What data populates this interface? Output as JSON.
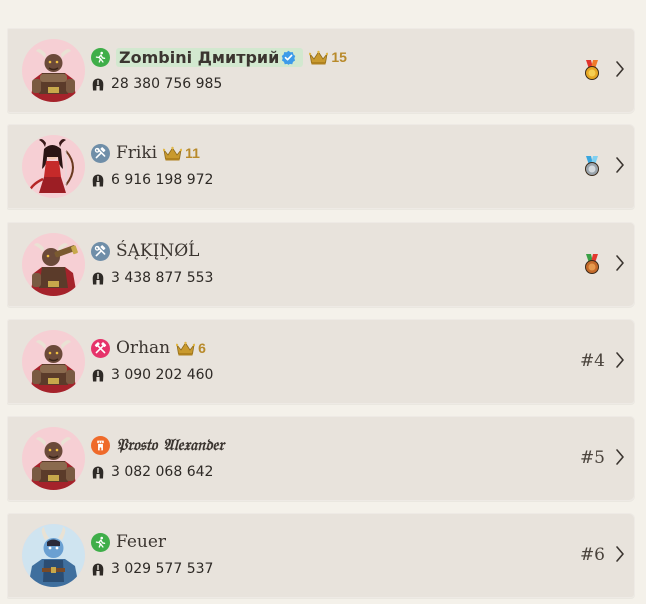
{
  "colors": {
    "card_bg": "#e8e3dc",
    "avatar_bg": "#f6cfd4",
    "class_green": "#3fae49",
    "class_gray": "#6f8ea8",
    "class_pink": "#e6336a",
    "class_orange": "#ef6a2a",
    "crown_gold": "#c99a2e",
    "verified_blue": "#3d9be9"
  },
  "players": [
    {
      "name": "Zombini Дмитрий",
      "class_icon": "archer-icon",
      "class_color": "#3fae49",
      "verified": true,
      "highlight": true,
      "crown_level": "15",
      "power": "28 380 756 985",
      "medal": "gold",
      "avatar": "minotaur-warrior"
    },
    {
      "name": "Friki",
      "class_icon": "tools-icon",
      "class_color": "#6f8ea8",
      "verified": false,
      "highlight": false,
      "crown_level": "11",
      "power": "6 916 198 972",
      "medal": "silver",
      "avatar": "demon-archer"
    },
    {
      "name": "ŚĄĶĮŅØĹ",
      "class_icon": "tools-icon",
      "class_color": "#6f8ea8",
      "verified": false,
      "highlight": false,
      "crown_level": null,
      "power": "3 438 877 553",
      "medal": "bronze",
      "avatar": "minotaur-spyglass"
    },
    {
      "name": "Orhan",
      "class_icon": "crossed-hammers-icon",
      "class_color": "#e6336a",
      "verified": false,
      "highlight": false,
      "crown_level": "6",
      "power": "3 090 202 460",
      "rank": "#4",
      "avatar": "minotaur-warrior"
    },
    {
      "name": "𝔓𝔯𝔬𝔰𝔱𝔬 𝔄𝔩𝔢𝔵𝔞𝔫𝔡𝔢𝔯",
      "class_icon": "tower-icon",
      "class_color": "#ef6a2a",
      "verified": false,
      "highlight": false,
      "crown_level": null,
      "power": "3 082 068 642",
      "rank": "#5",
      "avatar": "minotaur-warrior"
    },
    {
      "name": "Feuer",
      "class_icon": "archer-icon",
      "class_color": "#3fae49",
      "verified": false,
      "highlight": false,
      "crown_level": null,
      "power": "3 029 577 537",
      "rank": "#6",
      "avatar": "blue-demon"
    }
  ]
}
